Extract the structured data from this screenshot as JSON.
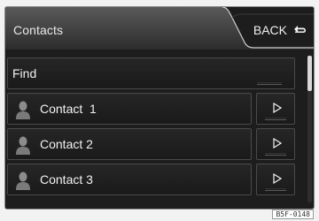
{
  "header": {
    "title": "Contacts",
    "back_label": "BACK",
    "back_icon": "return-arrow-icon"
  },
  "find_row": {
    "label": "Find"
  },
  "contacts": [
    {
      "name": "Contact  1",
      "icon": "person-silhouette-icon",
      "action_icon": "play-arrow-icon"
    },
    {
      "name": "Contact 2",
      "icon": "person-silhouette-icon",
      "action_icon": "play-arrow-icon"
    },
    {
      "name": "Contact 3",
      "icon": "person-silhouette-icon",
      "action_icon": "play-arrow-icon"
    }
  ],
  "scroll": {
    "position": 0
  },
  "image_code": "B5F-0148",
  "colors": {
    "screen_bg": "#1d1d1d",
    "text": "#f2f2f2",
    "border": "#4a4a4a",
    "thumb": "#d8d8d8"
  }
}
